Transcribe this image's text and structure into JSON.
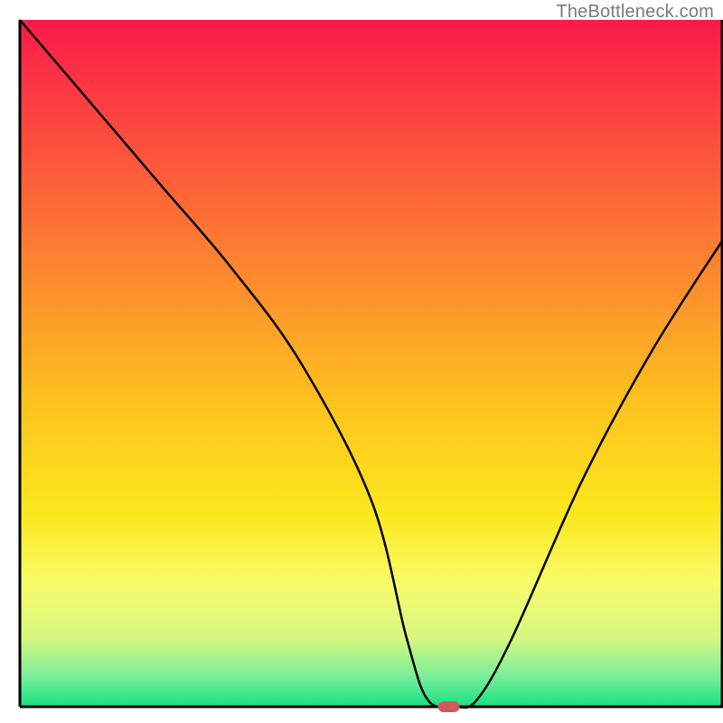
{
  "watermark": "TheBottleneck.com",
  "chart_data": {
    "type": "line",
    "title": "",
    "xlabel": "",
    "ylabel": "",
    "xlim": [
      0,
      100
    ],
    "ylim": [
      0,
      100
    ],
    "x": [
      0,
      10,
      20,
      30,
      40,
      50,
      55,
      58,
      62,
      65,
      70,
      80,
      90,
      100
    ],
    "values": [
      100,
      88,
      76,
      64,
      50,
      30,
      10,
      1,
      0,
      1,
      10,
      33,
      52,
      68
    ],
    "marker": {
      "x": 61,
      "y": 0,
      "color": "#d15a5f",
      "rx": 12,
      "ry": 6
    },
    "background_gradient": {
      "stops": [
        {
          "offset": 0.0,
          "color": "#fb1a4a"
        },
        {
          "offset": 0.3,
          "color": "#fd7334"
        },
        {
          "offset": 0.55,
          "color": "#fdc01f"
        },
        {
          "offset": 0.72,
          "color": "#fbe81c"
        },
        {
          "offset": 0.82,
          "color": "#f8fb6b"
        },
        {
          "offset": 0.9,
          "color": "#d6f77f"
        },
        {
          "offset": 0.955,
          "color": "#7bee9a"
        },
        {
          "offset": 1.0,
          "color": "#17e183"
        }
      ]
    },
    "axis_color": "#000000",
    "curve_color": "#000000",
    "curve_width": 2.5
  }
}
